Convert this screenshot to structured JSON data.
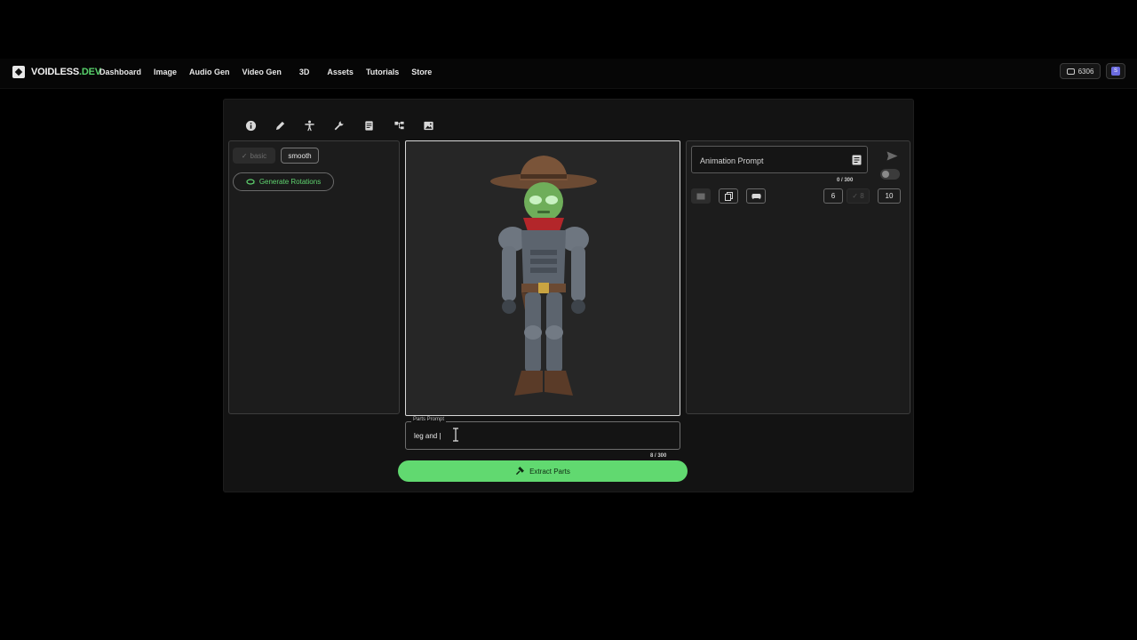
{
  "header": {
    "brand_main": "VOIDLESS",
    "brand_suffix": ".DEV",
    "nav": [
      "Dashboard",
      "Image",
      "Audio Gen",
      "Video Gen",
      "3D",
      "Assets",
      "Tutorials",
      "Store"
    ],
    "credits": "6306",
    "avatar_initial": "S"
  },
  "toolbar": {
    "icons": [
      "info-icon",
      "pencil-icon",
      "figure-icon",
      "wrench-icon",
      "document-icon",
      "hierarchy-icon",
      "image-icon"
    ]
  },
  "left_panel": {
    "chip_basic": "basic",
    "chip_smooth": "smooth",
    "generate_rotations": "Generate Rotations"
  },
  "parts": {
    "legend": "Parts Prompt",
    "value": "leg and |",
    "count": "8 / 300",
    "extract_label": "Extract Parts"
  },
  "animation": {
    "placeholder": "Animation Prompt",
    "count": "0 / 300",
    "frames_6": "6",
    "frames_8": "8",
    "frames_10": "10"
  },
  "colors": {
    "accent": "#61d970",
    "background": "#131313"
  }
}
